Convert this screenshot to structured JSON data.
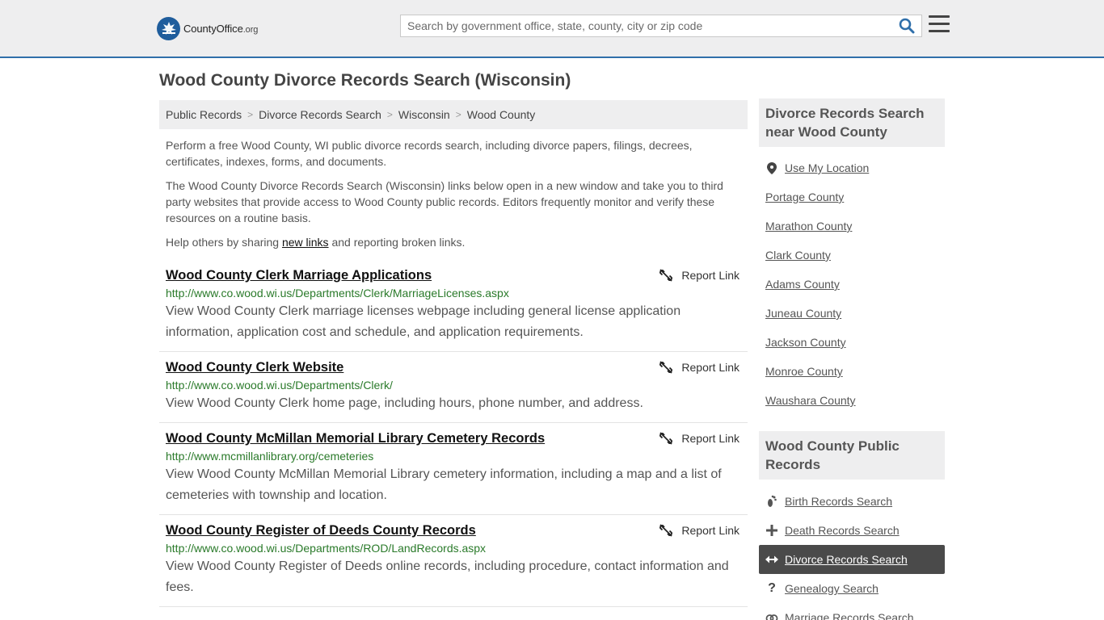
{
  "header": {
    "logo_brand": "CountyOffice",
    "logo_tld": ".org",
    "search_placeholder": "Search by government office, state, county, city or zip code"
  },
  "page_title": "Wood County Divorce Records Search (Wisconsin)",
  "breadcrumb": [
    "Public Records",
    "Divorce Records Search",
    "Wisconsin",
    "Wood County"
  ],
  "intro": {
    "p1": "Perform a free Wood County, WI public divorce records search, including divorce papers, filings, decrees, certificates, indexes, forms, and documents.",
    "p2": "The Wood County Divorce Records Search (Wisconsin) links below open in a new window and take you to third party websites that provide access to Wood County public records. Editors frequently monitor and verify these resources on a routine basis.",
    "p3_before": "Help others by sharing ",
    "p3_link": "new links",
    "p3_after": " and reporting broken links."
  },
  "report_label": "Report Link",
  "results": [
    {
      "title": "Wood County Clerk Marriage Applications",
      "url": "http://www.co.wood.wi.us/Departments/Clerk/MarriageLicenses.aspx",
      "desc": "View Wood County Clerk marriage licenses webpage including general license application information, application cost and schedule, and application requirements."
    },
    {
      "title": "Wood County Clerk Website",
      "url": "http://www.co.wood.wi.us/Departments/Clerk/",
      "desc": "View Wood County Clerk home page, including hours, phone number, and address."
    },
    {
      "title": "Wood County McMillan Memorial Library Cemetery Records",
      "url": "http://www.mcmillanlibrary.org/cemeteries",
      "desc": "View Wood County McMillan Memorial Library cemetery information, including a map and a list of cemeteries with township and location."
    },
    {
      "title": "Wood County Register of Deeds County Records",
      "url": "http://www.co.wood.wi.us/Departments/ROD/LandRecords.aspx",
      "desc": "View Wood County Register of Deeds online records, including procedure, contact information and fees."
    }
  ],
  "sidebar": {
    "nearby_heading": "Divorce Records Search near Wood County",
    "use_location": "Use My Location",
    "nearby": [
      "Portage County",
      "Marathon County",
      "Clark County",
      "Adams County",
      "Juneau County",
      "Jackson County",
      "Monroe County",
      "Waushara County"
    ],
    "public_heading": "Wood County Public Records",
    "public": [
      {
        "label": "Birth Records Search",
        "icon": "footprint-icon"
      },
      {
        "label": "Death Records Search",
        "icon": "cross-icon"
      },
      {
        "label": "Divorce Records Search",
        "icon": "arrows-icon"
      },
      {
        "label": "Genealogy Search",
        "icon": "question-icon"
      },
      {
        "label": "Marriage Records Search",
        "icon": "rings-icon"
      }
    ]
  },
  "colors": {
    "header_bg": "#eeeeef",
    "header_border": "#2f6faa",
    "url_green": "#2a7a2a",
    "active_bg": "#4a4a4a"
  }
}
